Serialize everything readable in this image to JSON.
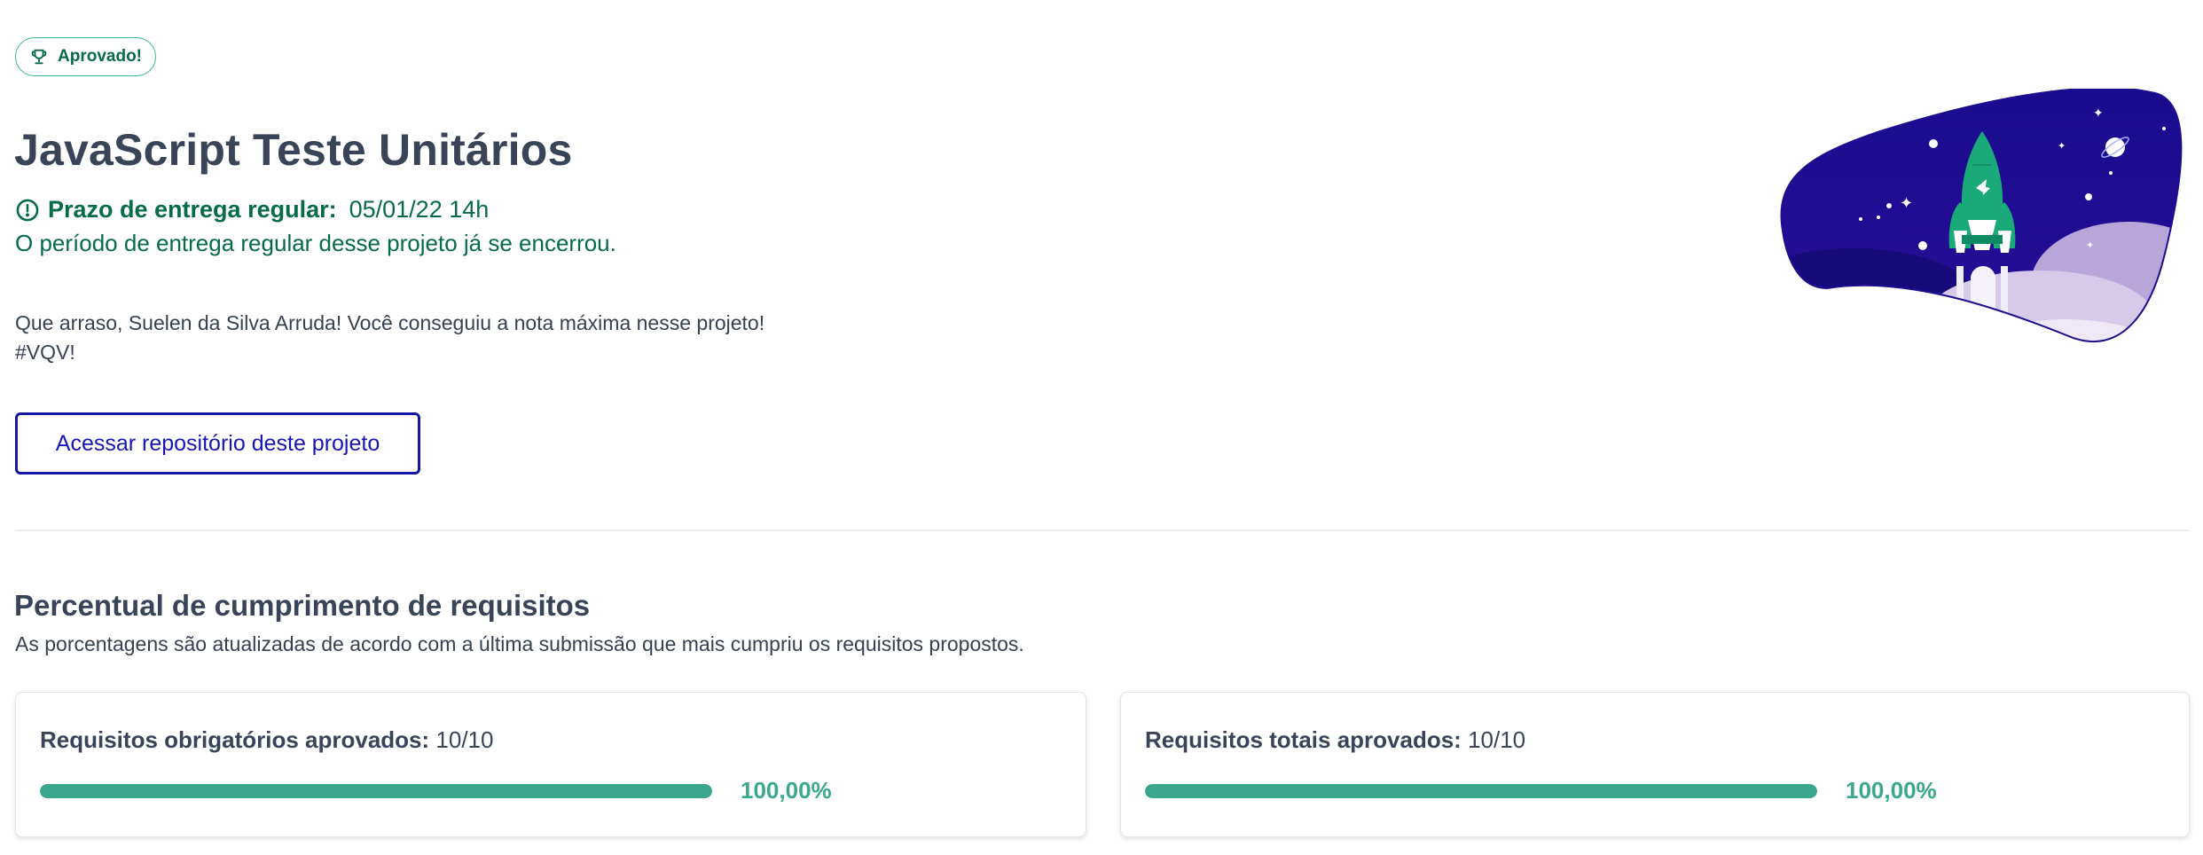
{
  "badge": {
    "label": "Aprovado!",
    "icon": "trophy-icon"
  },
  "project": {
    "title": "JavaScript Teste Unitários",
    "deadline_label": "Prazo de entrega regular:",
    "deadline_value": "05/01/22 14h",
    "deadline_icon": "alert-circle-icon",
    "closed_message": "O período de entrega regular desse projeto já se encerrou.",
    "congrats_line1": "Que arraso, Suelen da Silva Arruda! Você conseguiu a nota máxima nesse projeto!",
    "congrats_line2": "#VQV!",
    "repo_button": "Acessar repositório deste projeto"
  },
  "requirements": {
    "title": "Percentual de cumprimento de requisitos",
    "subtitle": "As porcentagens são atualizadas de acordo com a última submissão que mais cumpriu os requisitos propostos.",
    "cards": [
      {
        "label": "Requisitos obrigatórios aprovados:",
        "value": "10/10",
        "percent_text": "100,00%",
        "progress": 1.0
      },
      {
        "label": "Requisitos totais aprovados:",
        "value": "10/10",
        "percent_text": "100,00%",
        "progress": 1.0
      }
    ]
  },
  "colors": {
    "success_green": "#066b4a",
    "progress_green": "#3aa88c",
    "button_blue": "#1616a8",
    "illustration_night": "#1e0d8f"
  }
}
